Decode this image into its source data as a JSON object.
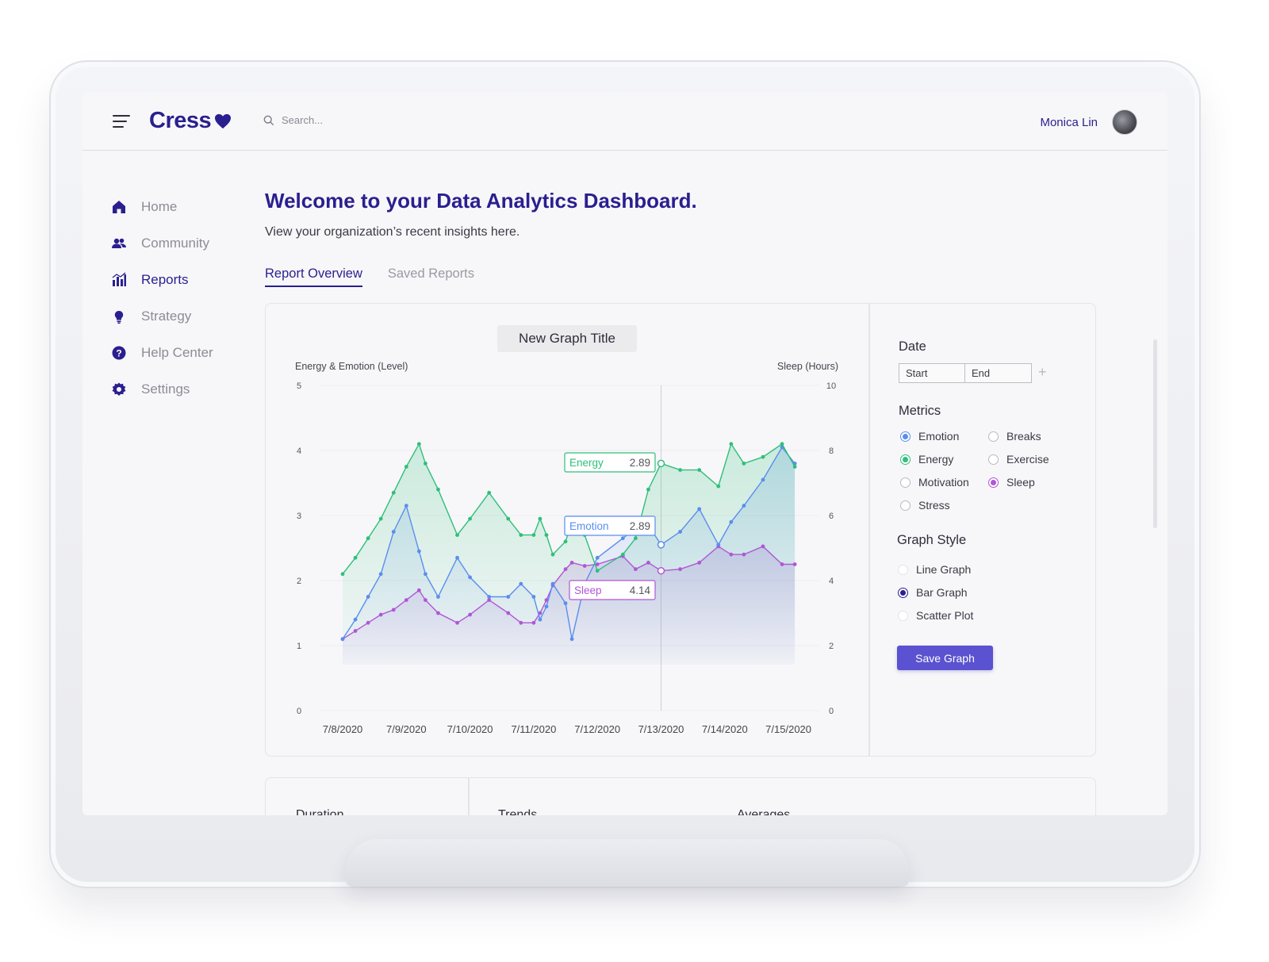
{
  "app": {
    "logo_text": "Cress",
    "brand_color": "#2a1f8f",
    "search_placeholder": "Search...",
    "user_name": "Monica Lin"
  },
  "sidebar": {
    "items": [
      {
        "label": "Home",
        "icon": "home-icon"
      },
      {
        "label": "Community",
        "icon": "community-icon"
      },
      {
        "label": "Reports",
        "icon": "bar-chart-icon",
        "active": true
      },
      {
        "label": "Strategy",
        "icon": "lightbulb-icon"
      },
      {
        "label": "Help Center",
        "icon": "question-icon"
      },
      {
        "label": "Settings",
        "icon": "gear-icon"
      }
    ]
  },
  "main": {
    "title": "Welcome to your Data Analytics Dashboard.",
    "subtitle": "View your organization’s recent insights here.",
    "tabs": [
      {
        "label": "Report Overview",
        "active": true
      },
      {
        "label": "Saved Reports",
        "active": false
      }
    ]
  },
  "graph": {
    "title": "New Graph Title"
  },
  "panel": {
    "date_heading": "Date",
    "start_placeholder": "Start",
    "end_placeholder": "End",
    "add_symbol": "+",
    "metrics_heading": "Metrics",
    "metrics": [
      {
        "label": "Emotion",
        "checked": true,
        "color": "#5b8def"
      },
      {
        "label": "Breaks",
        "checked": false
      },
      {
        "label": "Energy",
        "checked": true,
        "color": "#2fbf7a"
      },
      {
        "label": "Exercise",
        "checked": false
      },
      {
        "label": "Motivation",
        "checked": false
      },
      {
        "label": "Sleep",
        "checked": true,
        "color": "#b057d6"
      },
      {
        "label": "Stress",
        "checked": false
      }
    ],
    "style_heading": "Graph Style",
    "styles": [
      {
        "label": "Line Graph",
        "checked": false
      },
      {
        "label": "Bar Graph",
        "checked": true
      },
      {
        "label": "Scatter Plot",
        "checked": false
      }
    ],
    "save_label": "Save Graph"
  },
  "summary": {
    "duration": "Duration",
    "trends": "Trends",
    "averages": "Averages"
  },
  "chart_data": {
    "type": "area",
    "ylabel": "Energy & Emotion (Level)",
    "y2label": "Sleep (Hours)",
    "ylim": [
      0,
      5
    ],
    "y2lim": [
      0,
      10
    ],
    "yticks": [
      "0",
      "1",
      "2",
      "3",
      "4",
      "5"
    ],
    "y2ticks": [
      "0",
      "2",
      "4",
      "6",
      "8",
      "10"
    ],
    "categories": [
      "7/8/2020",
      "7/9/2020",
      "7/10/2020",
      "7/11/2020",
      "7/12/2020",
      "7/13/2020",
      "7/14/2020",
      "7/15/2020"
    ],
    "x": [
      0,
      0.2,
      0.4,
      0.6,
      0.8,
      1.0,
      1.2,
      1.3,
      1.5,
      1.8,
      2.0,
      2.3,
      2.6,
      2.8,
      3.0,
      3.1,
      3.2,
      3.3,
      3.5,
      3.6,
      3.8,
      4.0,
      4.4,
      4.6,
      4.8,
      5.0,
      5.3,
      5.6,
      5.9,
      6.1,
      6.3,
      6.6,
      6.9,
      7.1
    ],
    "series": [
      {
        "name": "Energy",
        "color": "#2fbf7a",
        "axis": "left",
        "values": [
          2.1,
          2.35,
          2.65,
          2.95,
          3.35,
          3.75,
          4.1,
          3.8,
          3.4,
          2.7,
          2.95,
          3.35,
          2.95,
          2.7,
          2.7,
          2.95,
          2.7,
          2.4,
          2.6,
          2.9,
          2.7,
          2.15,
          2.4,
          2.65,
          3.4,
          3.8,
          3.7,
          3.7,
          3.45,
          4.1,
          3.8,
          3.9,
          4.1,
          3.75
        ]
      },
      {
        "name": "Emotion",
        "color": "#5b8def",
        "axis": "left",
        "values": [
          1.1,
          1.4,
          1.75,
          2.1,
          2.75,
          3.15,
          2.45,
          2.1,
          1.75,
          2.35,
          2.05,
          1.75,
          1.75,
          1.95,
          1.75,
          1.4,
          1.6,
          1.95,
          1.65,
          1.1,
          1.95,
          2.35,
          2.65,
          2.8,
          2.85,
          2.55,
          2.75,
          3.1,
          2.55,
          2.9,
          3.15,
          3.55,
          4.05,
          3.8
        ]
      },
      {
        "name": "Sleep",
        "color": "#b057d6",
        "axis": "right",
        "values": [
          2.2,
          2.45,
          2.7,
          2.95,
          3.1,
          3.4,
          3.7,
          3.4,
          3.0,
          2.7,
          2.95,
          3.4,
          3.0,
          2.7,
          2.7,
          3.0,
          3.4,
          3.85,
          4.35,
          4.55,
          4.45,
          4.5,
          4.75,
          4.35,
          4.55,
          4.3,
          4.35,
          4.55,
          5.05,
          4.8,
          4.8,
          5.05,
          4.5,
          4.5
        ]
      }
    ],
    "hover": {
      "x_category": "7/13/2020",
      "labels": [
        {
          "name": "Energy",
          "value": "2.89"
        },
        {
          "name": "Emotion",
          "value": "2.89"
        },
        {
          "name": "Sleep",
          "value": "4.14"
        }
      ]
    }
  }
}
